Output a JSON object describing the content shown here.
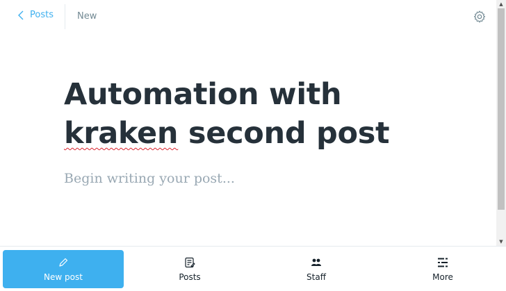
{
  "header": {
    "back_label": "Posts",
    "status": "New"
  },
  "editor": {
    "title_line1": "Automation with",
    "title_word_misspelled": "kraken",
    "title_rest": " second post",
    "body_placeholder": "Begin writing your post..."
  },
  "nav": {
    "items": [
      {
        "label": "New post",
        "icon": "pencil-icon",
        "active": true
      },
      {
        "label": "Posts",
        "icon": "posts-icon"
      },
      {
        "label": "Staff",
        "icon": "staff-icon"
      },
      {
        "label": "More",
        "icon": "more-icon"
      }
    ]
  },
  "colors": {
    "accent": "#3eb0ef",
    "title": "#26313a",
    "placeholder": "#99a8b3",
    "muted": "#738a94"
  }
}
